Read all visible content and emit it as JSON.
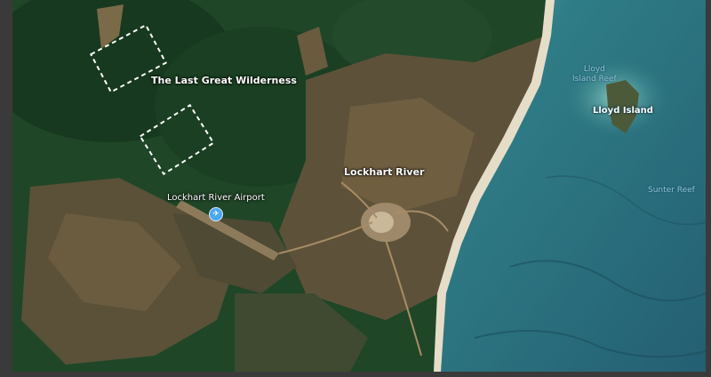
{
  "map": {
    "labels": {
      "wilderness": "The Last Great Wilderness",
      "town": "Lockhart River",
      "airport": "Lockhart River Airport",
      "lloyd_island_reef": "Lloyd\nIsland Reef",
      "lloyd_island": "Lloyd Island",
      "sunter_reef": "Sunter Reef"
    },
    "icons": {
      "airport": "airplane-icon"
    },
    "colors": {
      "forest": "#1f4a2a",
      "cleared_land": "#6e5a3e",
      "sea": "#2f6f7c",
      "beach": "#e8e0cc",
      "highlight_box": "#ffffff"
    }
  }
}
